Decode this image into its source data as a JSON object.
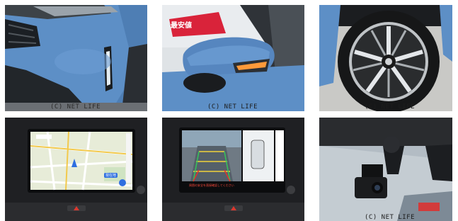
{
  "watermark": "(C) NET LIFE",
  "photos": [
    {
      "id": "front-bumper",
      "watermark": "(C) NET LIFE"
    },
    {
      "id": "side-mirror",
      "watermark": "(C) NET LIFE",
      "sign_text": "最安値"
    },
    {
      "id": "wheel",
      "watermark": "(C) NET LIFE"
    },
    {
      "id": "navigation-screen",
      "poi_label": "現在地"
    },
    {
      "id": "camera-screen",
      "caption": "周囲の安全を直接確認してください"
    },
    {
      "id": "dashcam",
      "watermark": "(C) NET LIFE"
    }
  ],
  "colors": {
    "body_blue": "#5d8fc6",
    "background": "#ffffff"
  }
}
